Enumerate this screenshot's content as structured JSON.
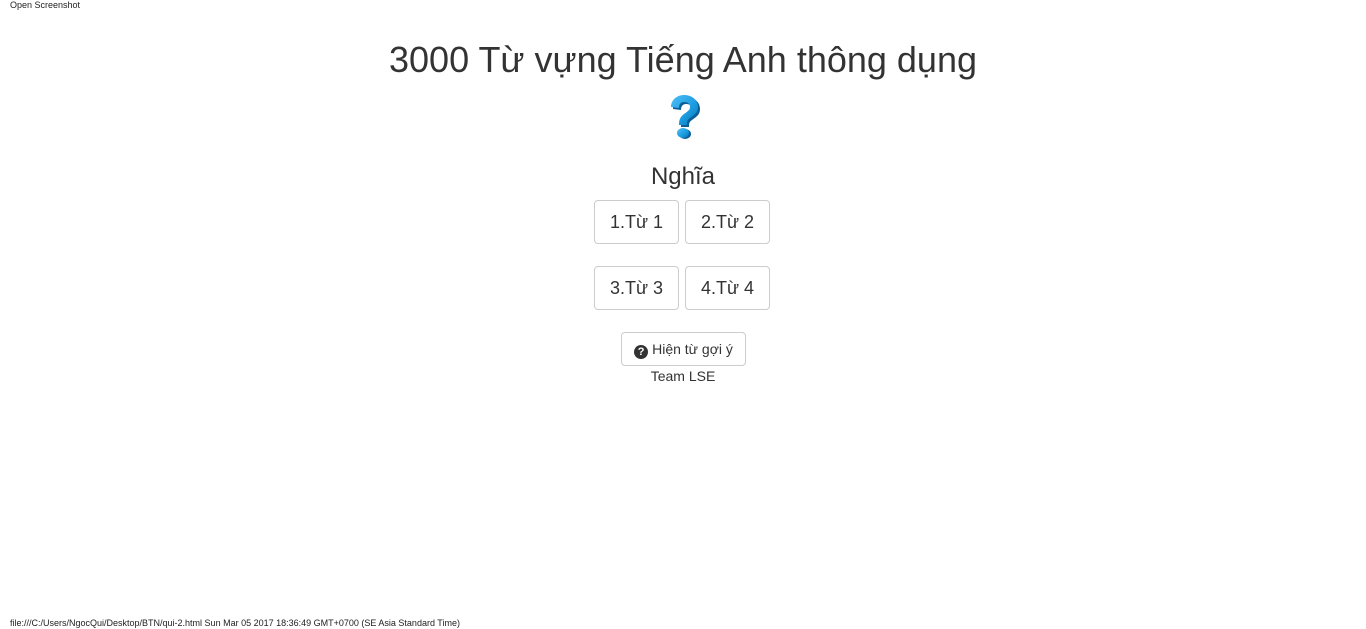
{
  "header": {
    "open_screenshot": "Open Screenshot"
  },
  "main": {
    "title": "3000 Từ vựng Tiếng Anh thông dụng",
    "question_icon": "question-mark-icon",
    "meaning": "Nghĩa",
    "options": [
      {
        "label": "1.Từ 1"
      },
      {
        "label": "2.Từ 2"
      },
      {
        "label": "3.Từ 3"
      },
      {
        "label": "4.Từ 4"
      }
    ],
    "hint_button": {
      "icon": "question-circle-icon",
      "icon_glyph": "?",
      "label": "Hiện từ gợi ý"
    },
    "team": "Team LSE"
  },
  "footer": {
    "print_info": "file:///C:/Users/NgocQui/Desktop/BTN/qui-2.html Sun Mar 05 2017 18:36:49 GMT+0700 (SE Asia Standard Time)"
  },
  "colors": {
    "text": "#333333",
    "border": "#cccccc",
    "question_mark_blue": "#1a9be0"
  }
}
